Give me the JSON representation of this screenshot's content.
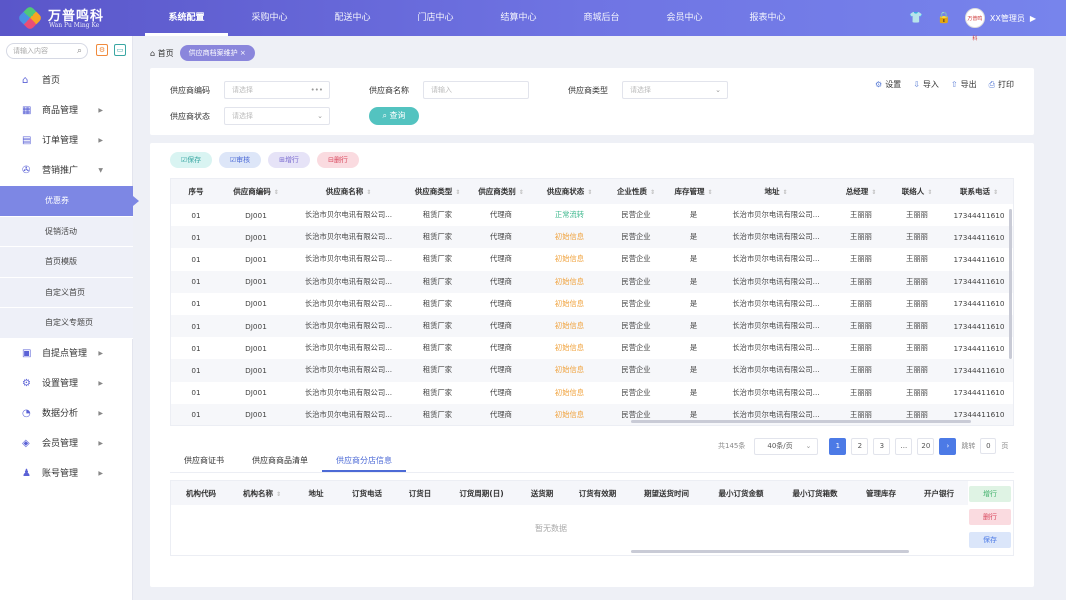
{
  "brand": {
    "name_cn": "万普鸣科",
    "name_en": "Wan Pu Ming Ke"
  },
  "nav": [
    "系统配置",
    "采购中心",
    "配送中心",
    "门店中心",
    "结算中心",
    "商城后台",
    "会员中心",
    "报表中心"
  ],
  "nav_active": 0,
  "user": {
    "name": "XX管理员",
    "avatar_text": "万普鸣科"
  },
  "sidebar": {
    "search_placeholder": "请输入内容",
    "menu_top": [
      {
        "label": "首页",
        "icon": "⌂",
        "name": "home",
        "arrow": ""
      },
      {
        "label": "商品管理",
        "icon": "▦",
        "name": "goods",
        "arrow": "▶"
      },
      {
        "label": "订单管理",
        "icon": "▤",
        "name": "orders",
        "arrow": "▶"
      },
      {
        "label": "营销推广",
        "icon": "✇",
        "name": "marketing",
        "arrow": "▼"
      }
    ],
    "submenu": [
      "优惠券",
      "促销活动",
      "首页模版",
      "自定义首页",
      "自定义专题页"
    ],
    "submenu_active": 0,
    "menu_bottom": [
      {
        "label": "自提点管理",
        "icon": "▣",
        "name": "pickup",
        "arrow": "▶"
      },
      {
        "label": "设置管理",
        "icon": "⚙",
        "name": "settings",
        "arrow": "▶"
      },
      {
        "label": "数据分析",
        "icon": "◔",
        "name": "analytics",
        "arrow": "▶"
      },
      {
        "label": "会员管理",
        "icon": "◈",
        "name": "members",
        "arrow": "▶"
      },
      {
        "label": "账号管理",
        "icon": "♟",
        "name": "accounts",
        "arrow": "▶"
      }
    ]
  },
  "breadcrumb": {
    "home": "首页",
    "current": "供应商档案维护",
    "close": "×"
  },
  "filters": {
    "code_label": "供应商编码",
    "code_placeholder": "请选择",
    "code_suffix": "•••",
    "name_label": "供应商名称",
    "name_placeholder": "请输入",
    "type_label": "供应商类型",
    "type_placeholder": "请选择",
    "status_label": "供应商状态",
    "status_placeholder": "请选择",
    "query": "查询"
  },
  "toolbar": {
    "settings": "设置",
    "import": "导入",
    "export": "导出",
    "print": "打印"
  },
  "actions": {
    "save": "保存",
    "audit": "审核",
    "add": "增行",
    "delete": "删行"
  },
  "table": {
    "headers": [
      "序号",
      "供应商编码",
      "供应商名称",
      "供应商类型",
      "供应商类别",
      "供应商状态",
      "企业性质",
      "库存管理",
      "地址",
      "总经理",
      "联络人",
      "联系电话"
    ],
    "rows": [
      [
        "01",
        "DJ001",
        "长治市贝尔电讯有限公司...",
        "租赁厂家",
        "代理商",
        "正常流转",
        "民营企业",
        "是",
        "长治市贝尔电讯有限公司...",
        "王丽丽",
        "王丽丽",
        "17344411610"
      ],
      [
        "01",
        "DJ001",
        "长治市贝尔电讯有限公司...",
        "租赁厂家",
        "代理商",
        "初始信息",
        "民营企业",
        "是",
        "长治市贝尔电讯有限公司...",
        "王丽丽",
        "王丽丽",
        "17344411610"
      ],
      [
        "01",
        "DJ001",
        "长治市贝尔电讯有限公司...",
        "租赁厂家",
        "代理商",
        "初始信息",
        "民营企业",
        "是",
        "长治市贝尔电讯有限公司...",
        "王丽丽",
        "王丽丽",
        "17344411610"
      ],
      [
        "01",
        "DJ001",
        "长治市贝尔电讯有限公司...",
        "租赁厂家",
        "代理商",
        "初始信息",
        "民营企业",
        "是",
        "长治市贝尔电讯有限公司...",
        "王丽丽",
        "王丽丽",
        "17344411610"
      ],
      [
        "01",
        "DJ001",
        "长治市贝尔电讯有限公司...",
        "租赁厂家",
        "代理商",
        "初始信息",
        "民营企业",
        "是",
        "长治市贝尔电讯有限公司...",
        "王丽丽",
        "王丽丽",
        "17344411610"
      ],
      [
        "01",
        "DJ001",
        "长治市贝尔电讯有限公司...",
        "租赁厂家",
        "代理商",
        "初始信息",
        "民营企业",
        "是",
        "长治市贝尔电讯有限公司...",
        "王丽丽",
        "王丽丽",
        "17344411610"
      ],
      [
        "01",
        "DJ001",
        "长治市贝尔电讯有限公司...",
        "租赁厂家",
        "代理商",
        "初始信息",
        "民营企业",
        "是",
        "长治市贝尔电讯有限公司...",
        "王丽丽",
        "王丽丽",
        "17344411610"
      ],
      [
        "01",
        "DJ001",
        "长治市贝尔电讯有限公司...",
        "租赁厂家",
        "代理商",
        "初始信息",
        "民营企业",
        "是",
        "长治市贝尔电讯有限公司...",
        "王丽丽",
        "王丽丽",
        "17344411610"
      ],
      [
        "01",
        "DJ001",
        "长治市贝尔电讯有限公司...",
        "租赁厂家",
        "代理商",
        "初始信息",
        "民营企业",
        "是",
        "长治市贝尔电讯有限公司...",
        "王丽丽",
        "王丽丽",
        "17344411610"
      ],
      [
        "01",
        "DJ001",
        "长治市贝尔电讯有限公司...",
        "租赁厂家",
        "代理商",
        "初始信息",
        "民营企业",
        "是",
        "长治市贝尔电讯有限公司...",
        "王丽丽",
        "王丽丽",
        "17344411610"
      ]
    ]
  },
  "pagination": {
    "total": "共145条",
    "page_size": "40条/页",
    "pages": [
      "1",
      "2",
      "3",
      "...",
      "20"
    ],
    "current": "1",
    "jump_label": "跳转",
    "jump_value": "0",
    "page_unit": "页"
  },
  "bottom_tabs": [
    "供应商证书",
    "供应商商品清单",
    "供应商分店信息"
  ],
  "bottom_tab_active": 2,
  "bottom_table": {
    "headers": [
      "机构代码",
      "机构名称",
      "地址",
      "订货电话",
      "订货日",
      "订货周期(日)",
      "送货期",
      "订货有效期",
      "期望送货时间",
      "最小订货金额",
      "最小订货箱数",
      "管理库存",
      "开户银行"
    ],
    "empty": "暂无数据"
  },
  "side_actions": {
    "add": "增行",
    "delete": "删行",
    "save": "保存"
  },
  "colors": {
    "accent": "#4c7ae6",
    "status_normal": "#3fb88e",
    "status_initial": "#f0a13a"
  }
}
